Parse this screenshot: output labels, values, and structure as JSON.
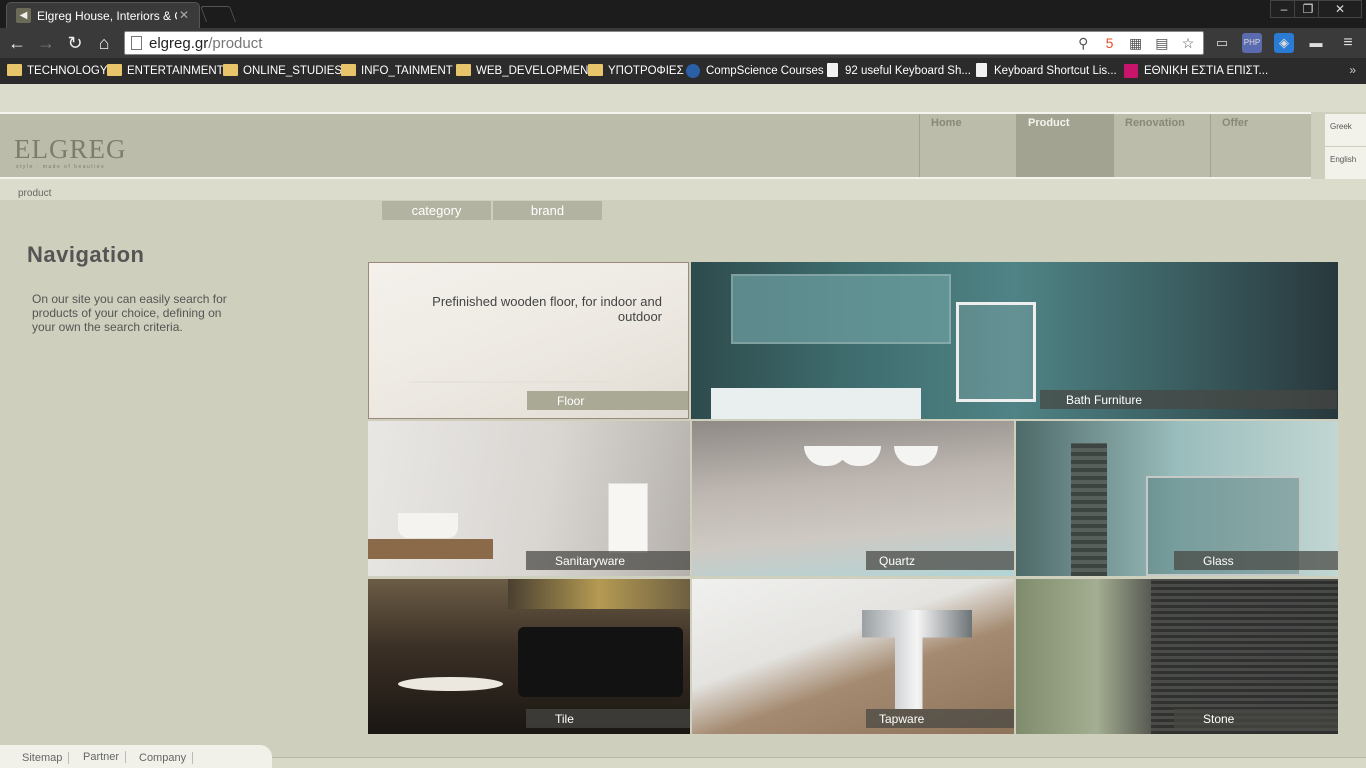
{
  "browser": {
    "tab_title": "Elgreg House, Interiors & Ou",
    "url_domain": "elgreg.gr",
    "url_path": "/product",
    "bookmarks": [
      {
        "label": "TECHNOLOGY",
        "icon": "folder-icon"
      },
      {
        "label": "ENTERTAINMENT",
        "icon": "folder-icon"
      },
      {
        "label": "ONLINE_STUDIES",
        "icon": "folder-icon"
      },
      {
        "label": "INFO_TAINMENT",
        "icon": "folder-icon"
      },
      {
        "label": "WEB_DEVELOPMENT",
        "icon": "folder-icon"
      },
      {
        "label": "ΥΠΟΤΡΟΦΙΕΣ",
        "icon": "folder-icon"
      },
      {
        "label": "CompScience Courses",
        "icon": "compscience-icon"
      },
      {
        "label": "92 useful Keyboard Sh...",
        "icon": "page-icon"
      },
      {
        "label": "Keyboard Shortcut Lis...",
        "icon": "page-icon"
      },
      {
        "label": "ΕΘΝΙΚΗ ΕΣΤΙΑ ΕΠΙΣΤ...",
        "icon": "estia-icon"
      }
    ],
    "more_bookmarks": "»"
  },
  "header": {
    "logo_text": "ELGREG",
    "logo_tagline": "style · made of beauties",
    "nav": [
      "Home",
      "Product",
      "Renovation",
      "Offer"
    ],
    "active_nav": "Product",
    "languages": [
      "Greek",
      "English"
    ]
  },
  "breadcrumb": "product",
  "filters": [
    "category",
    "brand"
  ],
  "sidebar": {
    "title": "Navigation",
    "text": "On our site you can easily search for products of your choice, defining on your own the search criteria."
  },
  "products": {
    "floor": {
      "label": "Floor",
      "description": "Prefinished wooden floor, for indoor and outdoor"
    },
    "bath": {
      "label": "Bath Furniture"
    },
    "sanitary": {
      "label": "Sanitaryware"
    },
    "quartz": {
      "label": "Quartz"
    },
    "glass": {
      "label": "Glass"
    },
    "tile": {
      "label": "Tile"
    },
    "tapware": {
      "label": "Tapware"
    },
    "stone": {
      "label": "Stone"
    }
  },
  "footer": [
    "Sitemap",
    "Partner",
    "Company"
  ],
  "colors": {
    "page_bg": "#cfcfbd",
    "header_bg": "#bcbcaa",
    "nav_active": "#a3a392",
    "filter_bg": "#b3b3a1"
  }
}
